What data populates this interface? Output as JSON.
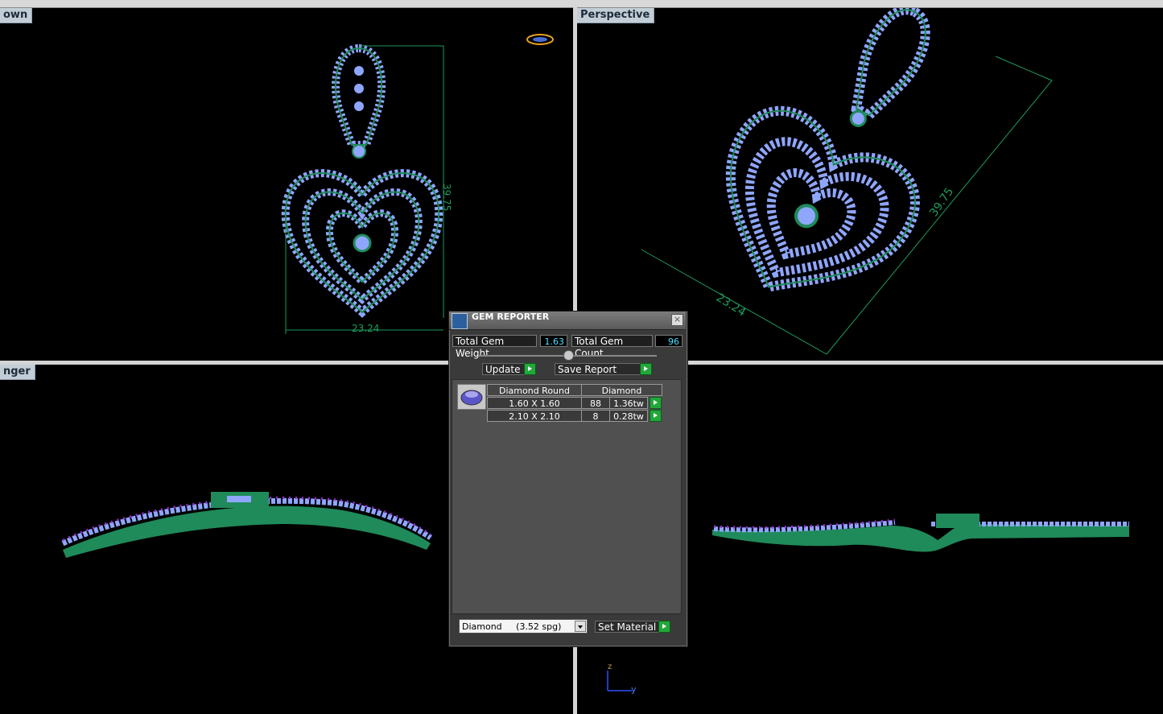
{
  "viewports": {
    "top_left_label": "own",
    "top_right_label": "Perspective",
    "bottom_left_label": "nger",
    "top_left_dims": {
      "height": "39.75",
      "width": "23.24"
    },
    "top_right_dims": {
      "height": "39.75",
      "width": "23.24"
    }
  },
  "axis": {
    "z": "z",
    "y": "y"
  },
  "gem_reporter": {
    "title": "GEM REPORTER",
    "total_gem_weight_label": "Total Gem Weight",
    "total_gem_weight": "1.63",
    "total_gem_count_label": "Total Gem Count",
    "total_gem_count": "96",
    "update_label": "Update",
    "save_report_label": "Save Report",
    "table": {
      "col1_header": "Diamond Round",
      "col2_header": "Diamond",
      "rows": [
        {
          "size": "1.60 X 1.60",
          "count": "88",
          "weight": "1.36tw"
        },
        {
          "size": "2.10 X 2.10",
          "count": "8",
          "weight": "0.28tw"
        }
      ]
    },
    "material_select": "Diamond     (3.52 spg)",
    "set_material_label": "Set Material"
  },
  "colors": {
    "gem": "#8fa6ff",
    "metal": "#1f8a5a",
    "prong": "#9a2bd1",
    "dimension": "#1c9a5c",
    "gem_value": "#47e3ff"
  }
}
